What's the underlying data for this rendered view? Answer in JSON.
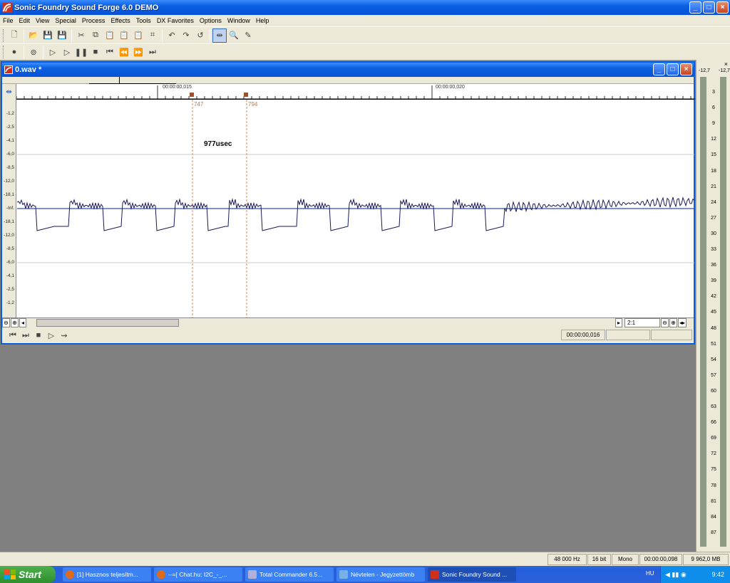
{
  "app": {
    "title": "Sonic Foundry Sound Forge 6.0 DEMO",
    "window_buttons": [
      "_",
      "□",
      "×"
    ]
  },
  "menu": [
    "File",
    "Edit",
    "View",
    "Special",
    "Process",
    "Effects",
    "Tools",
    "DX Favorites",
    "Options",
    "Window",
    "Help"
  ],
  "toolbar1_icons": [
    "new-icon",
    "open-icon",
    "save-icon",
    "save-as-icon",
    "cut-icon",
    "copy-icon",
    "paste-icon",
    "paste-special-icon",
    "mix-icon",
    "crop-icon",
    "undo-icon",
    "redo-icon",
    "repeat-icon",
    "edit-tool-icon",
    "magnify-tool-icon",
    "pencil-tool-icon"
  ],
  "toolbar2_icons": [
    "record-icon",
    "loop-icon",
    "play-all-icon",
    "play-icon",
    "pause-icon",
    "stop-icon",
    "go-start-icon",
    "rewind-icon",
    "forward-icon",
    "go-end-icon"
  ],
  "document": {
    "title": "0.wav *",
    "ruler": {
      "tick1": "00:00:00,015",
      "tick2": "00:00:00,020",
      "marker1": "747",
      "marker2": "794"
    },
    "annotation": "977usec",
    "db_labels": [
      "-1,2",
      "-2,5",
      "-4,1",
      "-6,0",
      "-8,5",
      "-12,0",
      "-18,1",
      "-Inf.",
      "-18,1",
      "-12,0",
      "-8,5",
      "-6,0",
      "-4,1",
      "-2,5",
      "-1,2"
    ],
    "zoom_ratio": "2:1",
    "position": "00:00:00,016"
  },
  "meter": {
    "peak_left": "-12,7",
    "peak_right": "-12,7",
    "close": "×",
    "scale": [
      "3",
      "6",
      "9",
      "12",
      "15",
      "18",
      "21",
      "24",
      "27",
      "30",
      "33",
      "36",
      "39",
      "42",
      "45",
      "48",
      "51",
      "54",
      "57",
      "60",
      "63",
      "66",
      "69",
      "72",
      "75",
      "78",
      "81",
      "84",
      "87"
    ]
  },
  "status": {
    "sample_rate": "48 000 Hz",
    "bit_depth": "16 bit",
    "channels": "Mono",
    "length": "00:00:00,098",
    "free_space": "9 962,0 MB"
  },
  "taskbar": {
    "start": "Start",
    "tasks": [
      {
        "label": "[1] Hasznos teljesítm...",
        "color": "#e06a1a"
      },
      {
        "label": "--=[ Chat.hu: I2C_-_...",
        "color": "#e06a1a"
      },
      {
        "label": "Total Commander 6.5...",
        "color": "#b0b0d8"
      },
      {
        "label": "Névtelen - Jegyzettömb",
        "color": "#7ab0e8"
      },
      {
        "label": "Sonic Foundry Sound ...",
        "color": "#d0301a"
      }
    ],
    "lang": "HU",
    "clock": "9:42"
  }
}
